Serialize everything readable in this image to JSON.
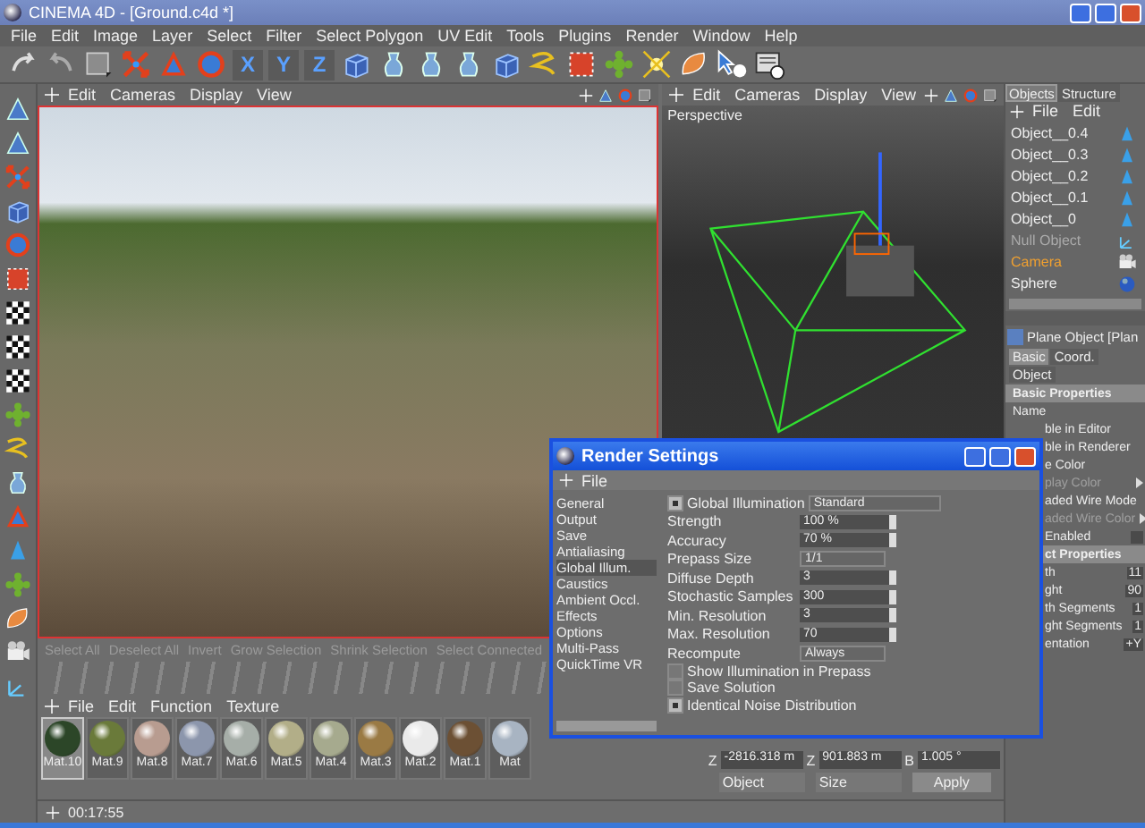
{
  "window": {
    "title": "CINEMA 4D - [Ground.c4d *]"
  },
  "menu_bar": [
    "File",
    "Edit",
    "Image",
    "Layer",
    "Select",
    "Filter",
    "Select Polygon",
    "UV Edit",
    "Tools",
    "Plugins",
    "Render",
    "Window",
    "Help"
  ],
  "toolbar": {
    "axis_buttons": [
      "X",
      "Y",
      "Z"
    ]
  },
  "viewports": [
    {
      "kind": "render",
      "menu": [
        "Edit",
        "Cameras",
        "Display",
        "View"
      ]
    },
    {
      "kind": "perspective",
      "menu": [
        "Edit",
        "Cameras",
        "Display",
        "View"
      ],
      "label": "Perspective"
    }
  ],
  "selection_bar": [
    "Select All",
    "Deselect All",
    "Invert",
    "Grow Selection",
    "Shrink Selection",
    "Select Connected"
  ],
  "material_manager": {
    "menu": [
      "File",
      "Edit",
      "Function",
      "Texture"
    ],
    "materials": [
      {
        "name": "Mat.10",
        "color": "#2c4628",
        "selected": true
      },
      {
        "name": "Mat.9",
        "color": "#6a7a3a",
        "selected": false
      },
      {
        "name": "Mat.8",
        "color": "#b89c90",
        "selected": false
      },
      {
        "name": "Mat.7",
        "color": "#8c96ac",
        "selected": false
      },
      {
        "name": "Mat.6",
        "color": "#a6aea8",
        "selected": false
      },
      {
        "name": "Mat.5",
        "color": "#b2ae88",
        "selected": false
      },
      {
        "name": "Mat.4",
        "color": "#a6aa8e",
        "selected": false
      },
      {
        "name": "Mat.3",
        "color": "#9a7a44",
        "selected": false
      },
      {
        "name": "Mat.2",
        "color": "#eaeaea",
        "selected": false
      },
      {
        "name": "Mat.1",
        "color": "#6c5034",
        "selected": false
      },
      {
        "name": "Mat",
        "color": "#a8b4c2",
        "selected": false
      }
    ]
  },
  "status_bar": {
    "time": "00:17:55"
  },
  "object_manager": {
    "tabs": [
      {
        "label": "Objects",
        "selected": true
      },
      {
        "label": "Structure",
        "selected": false
      }
    ],
    "menu": [
      "File",
      "Edit"
    ],
    "objects": [
      {
        "name": "Object__0.4",
        "kind": "cone",
        "selected": false,
        "disabled": false
      },
      {
        "name": "Object__0.3",
        "kind": "cone",
        "selected": false,
        "disabled": false
      },
      {
        "name": "Object__0.2",
        "kind": "cone",
        "selected": false,
        "disabled": false
      },
      {
        "name": "Object__0.1",
        "kind": "cone",
        "selected": false,
        "disabled": false
      },
      {
        "name": "Object__0",
        "kind": "cone",
        "selected": false,
        "disabled": false
      },
      {
        "name": "Null Object",
        "kind": "null",
        "selected": false,
        "disabled": true
      },
      {
        "name": "Camera",
        "kind": "camera",
        "selected": true,
        "disabled": false
      },
      {
        "name": "Sphere",
        "kind": "sphere",
        "selected": false,
        "disabled": false
      }
    ]
  },
  "attribute_manager": {
    "title": "Plane Object [Plan",
    "tabs": [
      {
        "label": "Basic",
        "selected": true
      },
      {
        "label": "Coord.",
        "selected": false
      },
      {
        "label": "Object",
        "selected": false
      }
    ],
    "rows": [
      {
        "kind": "header",
        "label": "Basic Properties",
        "disabled": false
      },
      {
        "kind": "text",
        "label": "Name",
        "disabled": false
      },
      {
        "kind": "text",
        "label": "ble in Editor",
        "disabled": false
      },
      {
        "kind": "text",
        "label": "ble in Renderer",
        "disabled": false
      },
      {
        "kind": "text",
        "label": "e Color",
        "disabled": false
      },
      {
        "kind": "arrow",
        "label": "play Color",
        "disabled": true
      },
      {
        "kind": "text",
        "label": "aded Wire Mode",
        "disabled": false
      },
      {
        "kind": "arrow",
        "label": "aded Wire Color",
        "disabled": true
      },
      {
        "kind": "checkbox",
        "label": "Enabled",
        "checked": false,
        "disabled": false
      },
      {
        "kind": "header",
        "label": "ct Properties",
        "disabled": false
      },
      {
        "kind": "value",
        "label": "th",
        "value": "11",
        "disabled": false
      },
      {
        "kind": "value",
        "label": "ght",
        "value": "90",
        "disabled": false
      },
      {
        "kind": "value",
        "label": "th Segments",
        "value": "1",
        "disabled": false
      },
      {
        "kind": "value",
        "label": "ght Segments",
        "value": "1",
        "disabled": false
      },
      {
        "kind": "value",
        "label": "entation",
        "value": "+Y",
        "disabled": false
      }
    ]
  },
  "coordinates": {
    "rows": [
      [
        {
          "axis": "Z",
          "value": "-2816.318 m"
        },
        {
          "axis": "Z",
          "value": "901.883 m"
        },
        {
          "axis": "B",
          "value": "1.005 °"
        }
      ]
    ],
    "dropdowns": [
      "Object",
      "Size"
    ],
    "button": "Apply"
  },
  "render_settings": {
    "title": "Render Settings",
    "menu": [
      "File"
    ],
    "pages": [
      {
        "label": "General",
        "selected": false
      },
      {
        "label": "Output",
        "selected": false
      },
      {
        "label": "Save",
        "selected": false
      },
      {
        "label": "Antialiasing",
        "selected": false
      },
      {
        "label": "Global Illum.",
        "selected": true
      },
      {
        "label": "Caustics",
        "selected": false
      },
      {
        "label": "Ambient Occl.",
        "selected": false
      },
      {
        "label": "Effects",
        "selected": false
      },
      {
        "label": "Options",
        "selected": false
      },
      {
        "label": "Multi-Pass",
        "selected": false
      },
      {
        "label": "QuickTime VR",
        "selected": false
      }
    ],
    "gi": {
      "label": "Global Illumination",
      "checked": true,
      "mode": "Standard"
    },
    "fields": [
      {
        "label": "Strength",
        "value": "100 %",
        "kind": "spinner"
      },
      {
        "label": "Accuracy",
        "value": "70 %",
        "kind": "spinner"
      },
      {
        "label": "Prepass Size",
        "value": "1/1",
        "kind": "dropdown"
      },
      {
        "label": "Diffuse Depth",
        "value": "3",
        "kind": "spinner"
      },
      {
        "label": "Stochastic Samples",
        "value": "300",
        "kind": "spinner"
      },
      {
        "label": "Min. Resolution",
        "value": "3",
        "kind": "spinner"
      },
      {
        "label": "Max. Resolution",
        "value": "70",
        "kind": "spinner"
      },
      {
        "label": "Recompute",
        "value": "Always",
        "kind": "dropdown"
      }
    ],
    "options": [
      {
        "label": "Show Illumination in Prepass",
        "checked": false
      },
      {
        "label": "Save Solution",
        "checked": false
      },
      {
        "label": "Identical Noise Distribution",
        "checked": true
      }
    ]
  }
}
